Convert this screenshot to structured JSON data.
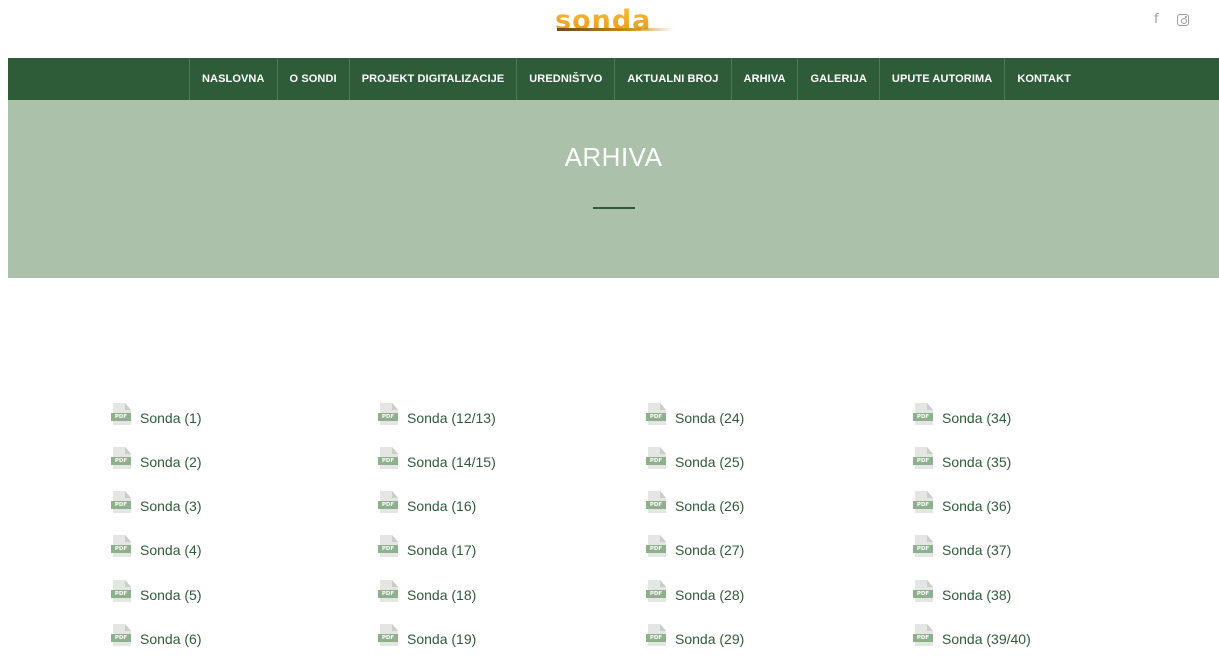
{
  "header": {
    "logo_text": "sonda",
    "social": {
      "facebook_icon": "f",
      "instagram_icon": "instagram-icon"
    }
  },
  "nav": {
    "items": [
      {
        "label": "NASLOVNA"
      },
      {
        "label": "O SONDI"
      },
      {
        "label": "PROJEKT DIGITALIZACIJE"
      },
      {
        "label": "UREDNIŠTVO"
      },
      {
        "label": "AKTUALNI BROJ"
      },
      {
        "label": "ARHIVA"
      },
      {
        "label": "GALERIJA"
      },
      {
        "label": "UPUTE AUTORIMA"
      },
      {
        "label": "KONTAKT"
      }
    ]
  },
  "hero": {
    "title": "ARHIVA"
  },
  "pdf_tag": "PDF",
  "archive": {
    "columns": [
      [
        "Sonda (1)",
        "Sonda (2)",
        "Sonda (3)",
        "Sonda (4)",
        "Sonda (5)",
        "Sonda (6)"
      ],
      [
        "Sonda (12/13)",
        "Sonda (14/15)",
        "Sonda (16)",
        "Sonda (17)",
        "Sonda (18)",
        "Sonda (19)"
      ],
      [
        "Sonda (24)",
        "Sonda (25)",
        "Sonda (26)",
        "Sonda (27)",
        "Sonda (28)",
        "Sonda (29)"
      ],
      [
        "Sonda (34)",
        "Sonda (35)",
        "Sonda (36)",
        "Sonda (37)",
        "Sonda (38)",
        "Sonda (39/40)"
      ]
    ]
  },
  "colors": {
    "nav_bg": "#2f5c38",
    "hero_bg": "#acc1aa",
    "link": "#2f5c38",
    "logo": "#f0a51e"
  }
}
